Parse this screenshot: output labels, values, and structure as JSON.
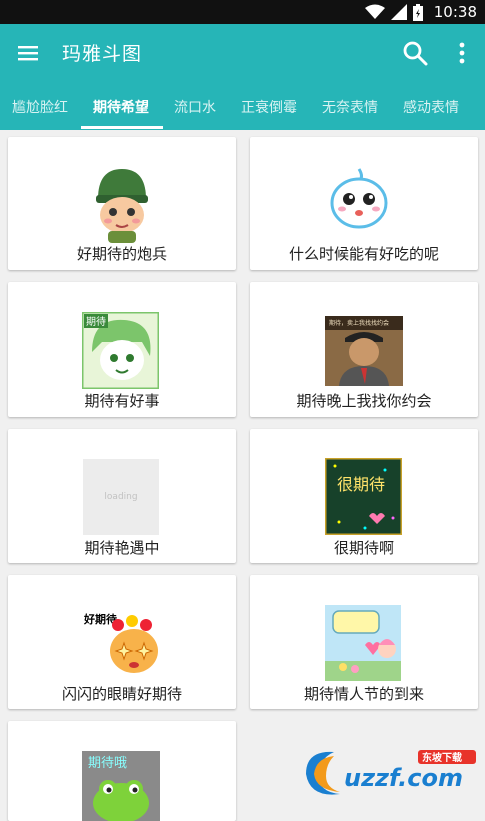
{
  "status_bar": {
    "time": "10:38"
  },
  "app_bar": {
    "title": "玛雅斗图"
  },
  "tabs": [
    {
      "label": "尴尬脸红"
    },
    {
      "label": "期待希望"
    },
    {
      "label": "流口水"
    },
    {
      "label": "正衰倒霉"
    },
    {
      "label": "无奈表情"
    },
    {
      "label": "感动表情"
    }
  ],
  "active_tab": "期待希望",
  "stickers": [
    {
      "caption": "好期待的炮兵"
    },
    {
      "caption": "什么时候能有好吃的呢"
    },
    {
      "caption": "期待有好事",
      "thumb_text": "期待"
    },
    {
      "caption": "期待晚上我找你约会",
      "thumb_text": "期待，卖上我找找约会"
    },
    {
      "caption": "期待艳遇中",
      "thumb_text": "loading"
    },
    {
      "caption": "很期待啊",
      "thumb_text": "很期待"
    },
    {
      "caption": "闪闪的眼睛好期待",
      "thumb_text": "好期待"
    },
    {
      "caption": "期待情人节的到来"
    },
    {
      "caption": "",
      "thumb_text": "期待哦"
    }
  ],
  "watermark": {
    "brand": "uzzf.com",
    "tag": "东坡下载"
  },
  "colors": {
    "primary": "#26b5b7",
    "statusbar": "#111111",
    "background": "#f0f0f0"
  }
}
